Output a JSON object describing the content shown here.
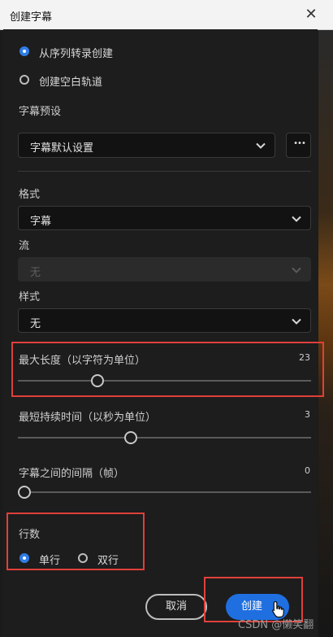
{
  "window": {
    "title": "创建字幕",
    "close_glyph": "✕"
  },
  "source": {
    "options": [
      {
        "label": "从序列转录创建",
        "selected": true
      },
      {
        "label": "创建空白轨道",
        "selected": false
      }
    ]
  },
  "preset": {
    "label": "字幕预设",
    "value": "字幕默认设置",
    "more_glyph": "•••"
  },
  "format": {
    "label": "格式",
    "value": "字幕"
  },
  "stream": {
    "label": "流",
    "value": "无",
    "disabled": true
  },
  "style": {
    "label": "样式",
    "value": "无"
  },
  "sliders": {
    "max_length": {
      "label": "最大长度（以字符为单位）",
      "value": "23",
      "level": 0.26
    },
    "min_duration": {
      "label": "最短持续时间（以秒为单位）",
      "value": "3",
      "level": 0.38
    },
    "gap": {
      "label": "字幕之间的间隔（帧）",
      "value": "0",
      "level": 0.0
    }
  },
  "lines": {
    "label": "行数",
    "options": [
      {
        "label": "单行",
        "selected": true
      },
      {
        "label": "双行",
        "selected": false
      }
    ]
  },
  "buttons": {
    "cancel": "取消",
    "create": "创建"
  },
  "watermark": "CSDN @懒笑翻",
  "colors": {
    "accent": "#1f6fe0",
    "highlight": "#e0403a"
  }
}
